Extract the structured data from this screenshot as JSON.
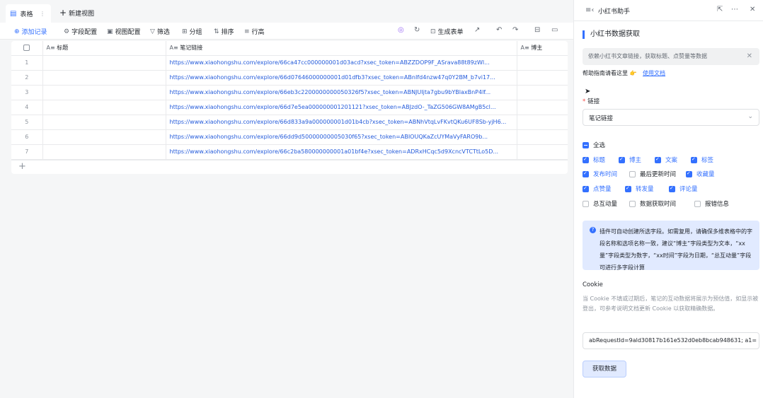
{
  "tabs": {
    "table_label": "表格",
    "new_view_label": "新建视图"
  },
  "toolbar": {
    "add_record": "添加记录",
    "field_config": "字段配置",
    "view_config": "视图配置",
    "filter": "筛选",
    "group": "分组",
    "sort": "排序",
    "row_height": "行高",
    "generate_form": "生成表单"
  },
  "grid": {
    "columns": [
      "标题",
      "笔记链接",
      "博主"
    ],
    "rows": [
      {
        "num": "1",
        "link": "https://www.xiaohongshu.com/explore/66ca47cc000000001d03acd?xsec_token=ABZZDOP9F_ASrava88t89zWl..."
      },
      {
        "num": "2",
        "link": "https://www.xiaohongshu.com/explore/66d07646000000001d01dfb3?xsec_token=ABnIfd4nzw47q0Y2BM_b7vi17..."
      },
      {
        "num": "3",
        "link": "https://www.xiaohongshu.com/explore/66eb3c2200000000050326f5?xsec_token=ABNJUIjta7gbu9bYBlaxBnP4lf..."
      },
      {
        "num": "4",
        "link": "https://www.xiaohongshu.com/explore/66d7e5ea000000001201121?xsec_token=ABJzdO-_TaZG506GW8AMgB5cl..."
      },
      {
        "num": "5",
        "link": "https://www.xiaohongshu.com/explore/66d833a9a000000001d01b4cb?xsec_token=ABNhVtqLvFKvtQKu6UF8Sb-yjH6..."
      },
      {
        "num": "6",
        "link": "https://www.xiaohongshu.com/explore/66dd9d50000000005030f65?xsec_token=ABIOUQKaZcUYMaVyFARO9b..."
      },
      {
        "num": "7",
        "link": "https://www.xiaohongshu.com/explore/66c2ba580000000001a01bf4e?xsec_token=ADRxHCqc5d9XcncVTCTtLo5D..."
      }
    ]
  },
  "side": {
    "title": "小红书助手",
    "section_title": "小红书数据获取",
    "notice": "依赖小红书文章链接，获取标题、点赞量等数据",
    "help_text": "帮助指南请看这里 👉",
    "help_link": "使用文档",
    "link_label": "链接",
    "link_select": "笔记链接",
    "select_all": "全选",
    "fields": [
      {
        "label": "标题",
        "checked": true
      },
      {
        "label": "博主",
        "checked": true
      },
      {
        "label": "文案",
        "checked": true
      },
      {
        "label": "标签",
        "checked": true
      },
      {
        "label": "发布时间",
        "checked": true
      },
      {
        "label": "最后更新时间",
        "checked": false
      },
      {
        "label": "收藏量",
        "checked": true
      },
      {
        "label": "点赞量",
        "checked": true
      },
      {
        "label": "转发量",
        "checked": true
      },
      {
        "label": "评论量",
        "checked": true
      },
      {
        "label": "总互动量",
        "checked": false
      },
      {
        "label": "数据获取时间",
        "checked": false
      },
      {
        "label": "报错信息",
        "checked": false
      }
    ],
    "info_text": "插件可自动创建所选字段。如需复用，请确保多维表格中的字段名称和选项名称一致，建议“博主”字段类型为文本，“xx量”字段类型为数字，“xx时间”字段为日期，“总互动量”字段可进行多字段计算",
    "cookie_title": "Cookie",
    "cookie_desc": "当 Cookie 不填或过期后，笔记的互动数据将展示为预估值，如显示被登出，可参考说明文档更新 Cookie 以获取精确数据。",
    "cookie_value": "abRequestId=9ald30817b161e532d0eb8bcab948631; a1=",
    "fetch_button": "获取数据"
  },
  "colors": {
    "accent": "#3370ff",
    "link": "#245bdb",
    "info_bg": "#e1eaff"
  }
}
